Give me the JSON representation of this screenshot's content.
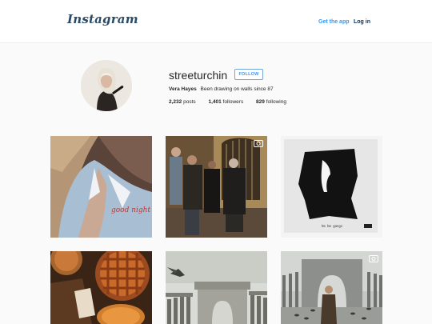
{
  "header": {
    "logo_text": "Instagram",
    "get_app_label": "Get the app",
    "login_label": "Log in"
  },
  "profile": {
    "username": "streeturchin",
    "follow_label": "FOLLOW",
    "full_name": "Vera Hayes",
    "bio": "Been drawing on walls since 87",
    "stats": {
      "posts_count": "2,232",
      "posts_label": "posts",
      "followers_count": "1,401",
      "followers_label": "followers",
      "following_count": "829",
      "following_label": "following"
    }
  },
  "posts": [
    {
      "subject": "woman-in-pajamas-good-night",
      "pajama_text": "good night",
      "is_video": false
    },
    {
      "subject": "people-at-gate",
      "is_video": true
    },
    {
      "subject": "album-cover",
      "album_caption": "hm hm gangs",
      "is_video": false
    },
    {
      "subject": "pies-on-table",
      "is_video": false
    },
    {
      "subject": "monument-with-bird",
      "is_video": false
    },
    {
      "subject": "woman-in-plaza-with-pigeons",
      "is_video": true
    }
  ],
  "colors": {
    "link_blue": "#3897f0",
    "login_dark_blue": "#003569",
    "logo": "#2b4a66",
    "background": "#fafafa"
  }
}
